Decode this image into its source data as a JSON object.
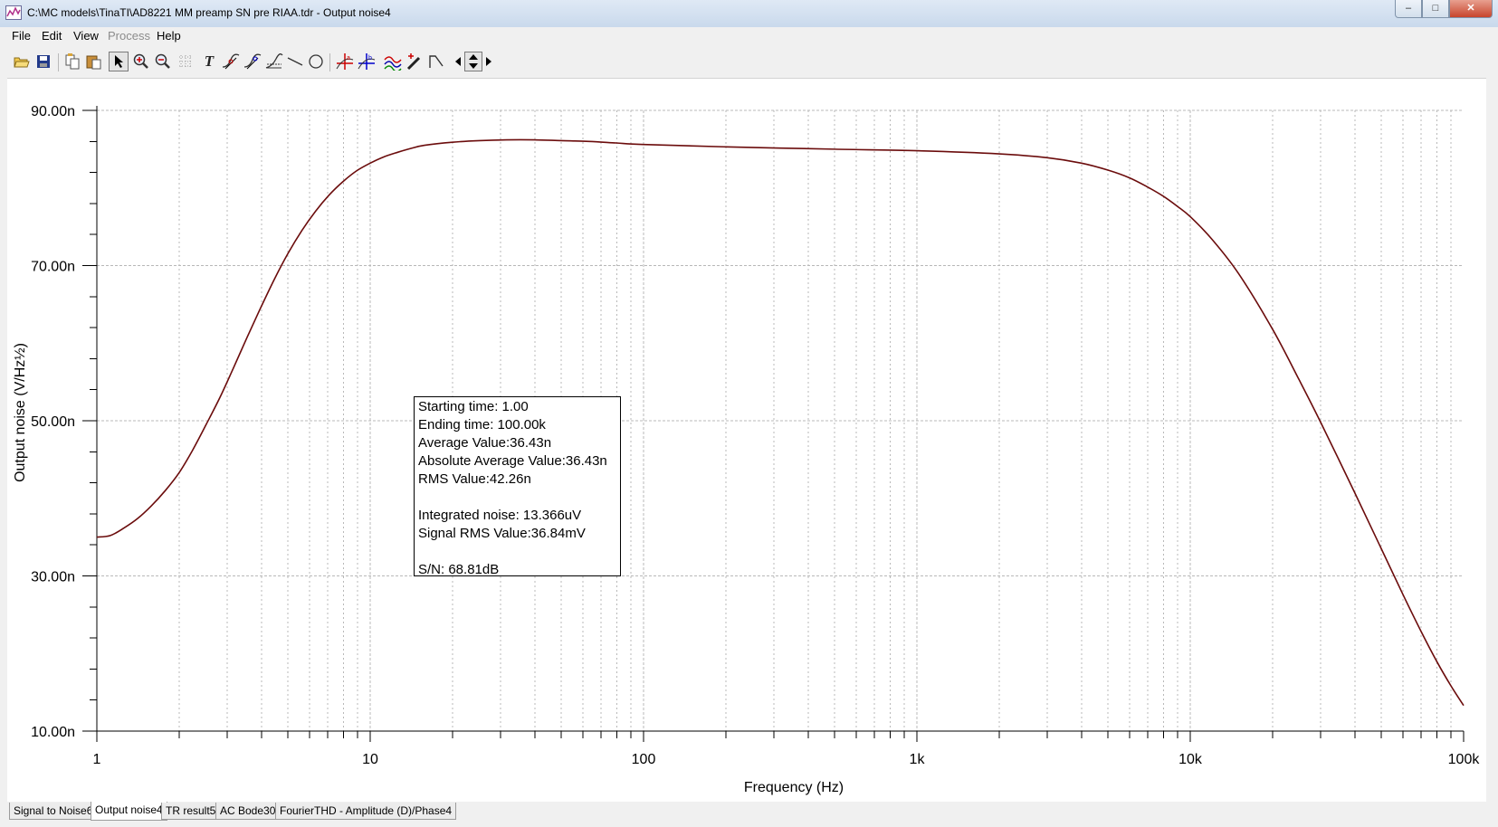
{
  "window": {
    "title": "C:\\MC models\\TinaTI\\AD8221 MM preamp SN pre RIAA.tdr - Output noise4",
    "app_icon": "chart-window-icon",
    "controls": {
      "minimize": "–",
      "maximize": "□",
      "close": "✕"
    }
  },
  "menu": {
    "file": "File",
    "edit": "Edit",
    "view": "View",
    "process": "Process",
    "help": "Help"
  },
  "toolbar": {
    "icons": [
      "open-folder-icon",
      "save-icon",
      "copy-icon",
      "paste-icon",
      "pointer-icon",
      "zoom-in-icon",
      "zoom-out-icon",
      "grid-icon",
      "text-icon",
      "cursor-a-icon",
      "cursor-b-icon",
      "axis-icon",
      "line-icon",
      "circle-icon",
      "marker-a-icon",
      "marker-b-icon",
      "curve-add-icon",
      "pen-icon",
      "slope-icon",
      "scroll-left-icon",
      "scroll-updown-icon",
      "scroll-right-icon"
    ],
    "text_button": "T"
  },
  "info": {
    "line1": "Starting time: 1.00",
    "line2": "Ending time: 100.00k",
    "line3": "Average Value:36.43n",
    "line4": "Absolute Average Value:36.43n",
    "line5": "RMS Value:42.26n",
    "line6": "Integrated noise: 13.366uV",
    "line7": "Signal RMS Value:36.84mV",
    "line8": "S/N: 68.81dB"
  },
  "tabs": [
    "Signal to Noise6",
    "Output noise4",
    "TR result5",
    "AC Bode30",
    "FourierTHD - Amplitude (D)/Phase4"
  ],
  "active_tab": "Output noise4",
  "colors": {
    "trace": "#6b0c0c",
    "grid": "#b8b8b8",
    "axis": "#000000",
    "window": "#f0f0f0"
  },
  "chart_data": {
    "type": "line",
    "xlabel": "Frequency (Hz)",
    "ylabel": "Output noise (V/Hz½)",
    "xscale": "log",
    "xlim": [
      1,
      100000
    ],
    "ylim": [
      1e-08,
      9e-08
    ],
    "xticks": [
      1,
      10,
      100,
      1000,
      10000,
      100000
    ],
    "xtick_labels": [
      "1",
      "10",
      "100",
      "1k",
      "10k",
      "100k"
    ],
    "yticks": [
      1e-08,
      3e-08,
      5e-08,
      7e-08,
      9e-08
    ],
    "ytick_labels": [
      "10.00n",
      "30.00n",
      "50.00n",
      "70.00n",
      "90.00n"
    ],
    "grid": true,
    "series": [
      {
        "x": [
          1,
          1.12,
          1.26,
          1.41,
          1.58,
          1.78,
          2,
          2.24,
          2.51,
          2.82,
          3.16,
          3.55,
          3.98,
          4.47,
          5.01,
          5.62,
          6.31,
          7.08,
          7.94,
          8.91,
          10,
          11.2,
          12.6,
          14.1,
          15.8,
          20,
          25.1,
          31.6,
          39.8,
          50.1,
          63.1,
          79.4,
          100,
          200,
          500,
          1000,
          2000,
          3000,
          4000,
          5000,
          6000,
          7000,
          8000,
          9000,
          10000,
          12000,
          15000,
          20000,
          25000,
          30000,
          40000,
          50000,
          60000,
          70000,
          80000,
          90000,
          100000
        ],
        "y": [
          3.5e-08,
          3.52e-08,
          3.62e-08,
          3.74e-08,
          3.9e-08,
          4.1e-08,
          4.33e-08,
          4.62e-08,
          4.95e-08,
          5.3e-08,
          5.68e-08,
          6.08e-08,
          6.46e-08,
          6.83e-08,
          7.16e-08,
          7.45e-08,
          7.7e-08,
          7.91e-08,
          8.08e-08,
          8.22e-08,
          8.32e-08,
          8.4e-08,
          8.46e-08,
          8.51e-08,
          8.55e-08,
          8.59e-08,
          8.61e-08,
          8.62e-08,
          8.62e-08,
          8.61e-08,
          8.6e-08,
          8.58e-08,
          8.56e-08,
          8.53e-08,
          8.5e-08,
          8.48e-08,
          8.44e-08,
          8.39e-08,
          8.32e-08,
          8.23e-08,
          8.13e-08,
          8.01e-08,
          7.89e-08,
          7.76e-08,
          7.63e-08,
          7.34e-08,
          6.9e-08,
          6.18e-08,
          5.53e-08,
          4.98e-08,
          4.07e-08,
          3.35e-08,
          2.76e-08,
          2.28e-08,
          1.89e-08,
          1.58e-08,
          1.33e-08
        ]
      }
    ]
  }
}
